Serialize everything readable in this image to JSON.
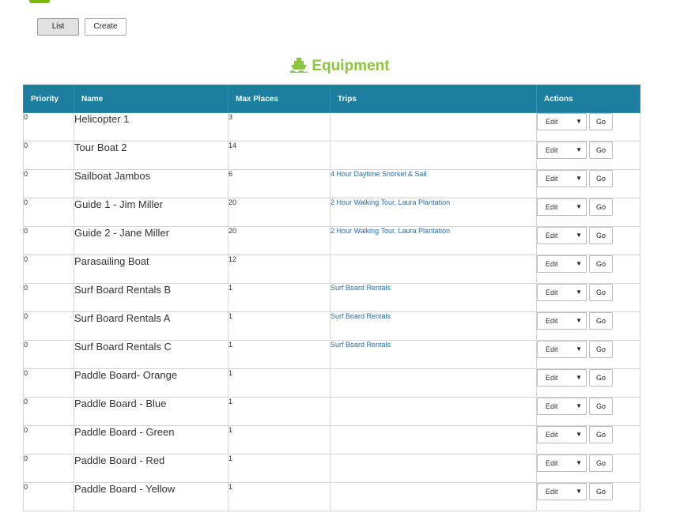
{
  "toolbar": {
    "list_label": "List",
    "create_label": "Create"
  },
  "page": {
    "title": "Equipment",
    "icon": "ship-icon",
    "accent_color": "#8cc63f",
    "header_color": "#1b7e9e"
  },
  "table": {
    "headers": [
      "Priority",
      "Name",
      "Max Places",
      "Trips",
      "Actions"
    ],
    "action_default": "Edit",
    "go_label": "Go",
    "rows": [
      {
        "priority": "0",
        "name": "Helicopter 1",
        "max": "3",
        "trips": ""
      },
      {
        "priority": "0",
        "name": "Tour Boat 2",
        "max": "14",
        "trips": ""
      },
      {
        "priority": "0",
        "name": "Sailboat Jambos",
        "max": "6",
        "trips": "4 Hour Daytime Snorkel & Sail"
      },
      {
        "priority": "0",
        "name": "Guide 1 - Jim Miller",
        "max": "20",
        "trips": "2 Hour Walking Tour, Laura Plantation"
      },
      {
        "priority": "0",
        "name": "Guide 2 - Jane Miller",
        "max": "20",
        "trips": "2 Hour Walking Tour, Laura Plantation"
      },
      {
        "priority": "0",
        "name": "Parasailing Boat",
        "max": "12",
        "trips": ""
      },
      {
        "priority": "0",
        "name": "Surf Board Rentals B",
        "max": "1",
        "trips": "Surf Board Rentals"
      },
      {
        "priority": "0",
        "name": "Surf Board Rentals A",
        "max": "1",
        "trips": "Surf Board Rentals"
      },
      {
        "priority": "0",
        "name": "Surf Board Rentals C",
        "max": "1",
        "trips": "Surf Board Rentals"
      },
      {
        "priority": "0",
        "name": "Paddle Board- Orange",
        "max": "1",
        "trips": ""
      },
      {
        "priority": "0",
        "name": "Paddle Board - Blue",
        "max": "1",
        "trips": ""
      },
      {
        "priority": "0",
        "name": "Paddle Board - Green",
        "max": "1",
        "trips": ""
      },
      {
        "priority": "0",
        "name": "Paddle Board - Red",
        "max": "1",
        "trips": ""
      },
      {
        "priority": "0",
        "name": "Paddle Board - Yellow",
        "max": "1",
        "trips": ""
      }
    ]
  }
}
